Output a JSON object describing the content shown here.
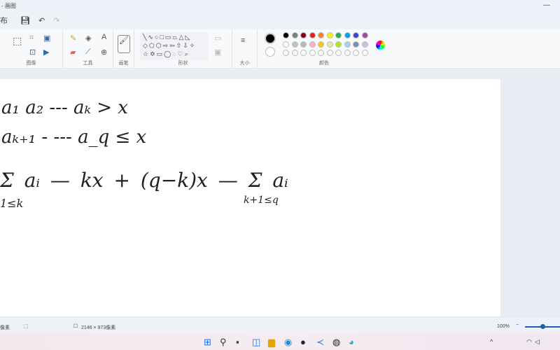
{
  "window": {
    "title": "- 画图"
  },
  "qat": {
    "left_label": "布",
    "save_icon": "save-icon",
    "undo_icon": "undo-icon",
    "redo_icon": "redo-icon"
  },
  "ribbon": {
    "groups": [
      "图像",
      "工具",
      "画笔",
      "形状",
      "大小",
      "颜色"
    ],
    "shapes": "╲∿○□▭⏢△◺\n◇⬠⬡⇨⇦⇧⇩✧\n☆✡▭◯◌♡⌕"
  },
  "colors": {
    "row1": [
      "#000000",
      "#7f7f7f",
      "#880015",
      "#ed1c24",
      "#ff7f27",
      "#fff200",
      "#22b14c",
      "#00a2e8",
      "#3f48cc",
      "#a349a4"
    ],
    "row2": [
      "#ffffff",
      "#c3c3c3",
      "#b9b9b9",
      "#ffaec9",
      "#ffc90e",
      "#efe4b0",
      "#b5e61d",
      "#99d9ea",
      "#7092be",
      "#c8bfe7"
    ],
    "primary": "#000000",
    "secondary": "#ffffff"
  },
  "canvas": {
    "handwriting": [
      "a₁ a₂ --- aₖ > x",
      "aₖ₊₁ - --- a_q ≤ x",
      "Σ aᵢ — kx + (q−k)x — Σ aᵢ",
      "1≤k",
      "k+1≤q"
    ]
  },
  "status": {
    "cursor": "像素",
    "dimensions": "2146 × 973像素",
    "zoom": "100%"
  }
}
